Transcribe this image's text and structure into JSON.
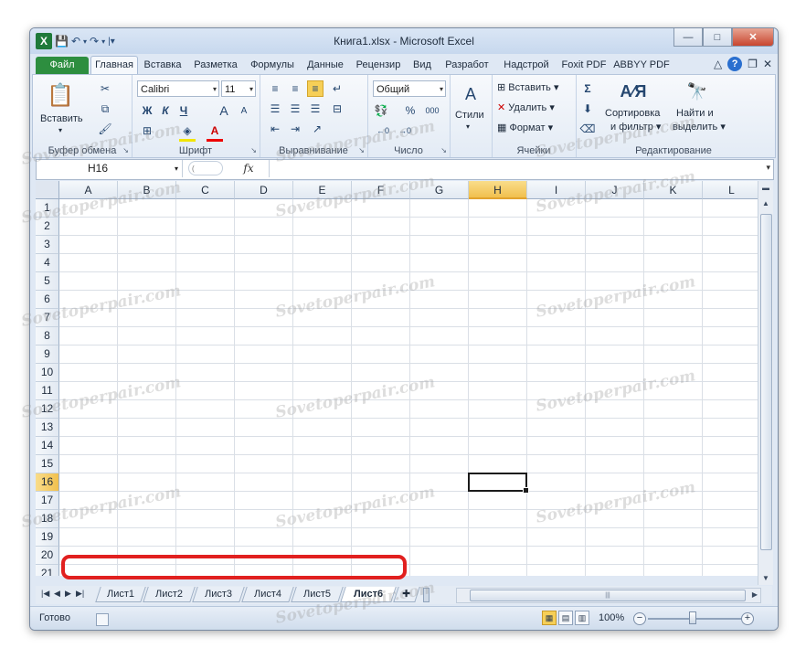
{
  "window": {
    "title": "Книга1.xlsx - Microsoft Excel",
    "quick_access": [
      "save-icon",
      "undo-icon",
      "redo-icon"
    ]
  },
  "tabs": {
    "file": "Файл",
    "items": [
      "Главная",
      "Вставка",
      "Разметка",
      "Формулы",
      "Данные",
      "Рецензир",
      "Вид",
      "Разработ",
      "Надстрой",
      "Foxit PDF",
      "ABBYY PDF"
    ],
    "active": "Главная"
  },
  "ribbon": {
    "clipboard": {
      "label": "Буфер обмена",
      "paste": "Вставить"
    },
    "font": {
      "label": "Шрифт",
      "name": "Calibri",
      "size": "11",
      "bold": "Ж",
      "italic": "К",
      "underline": "Ч",
      "grow": "A",
      "shrink": "A"
    },
    "alignment": {
      "label": "Выравнивание"
    },
    "number": {
      "label": "Число",
      "format": "Общий",
      "percent": "%",
      "thousands": "000"
    },
    "styles": {
      "label": "Стили"
    },
    "cells": {
      "label": "Ячейки",
      "insert": "Вставить",
      "delete": "Удалить",
      "format": "Формат"
    },
    "editing": {
      "label": "Редактирование",
      "sum": "Σ",
      "sort_line1": "Сортировка",
      "sort_line2": "и фильтр",
      "find_line1": "Найти и",
      "find_line2": "выделить"
    }
  },
  "formula_bar": {
    "name_box": "H16",
    "fx": "fx",
    "value": ""
  },
  "grid": {
    "columns": [
      "A",
      "B",
      "C",
      "D",
      "E",
      "F",
      "G",
      "H",
      "I",
      "J",
      "K",
      "L"
    ],
    "rows": [
      "1",
      "2",
      "3",
      "4",
      "5",
      "6",
      "7",
      "8",
      "9",
      "10",
      "11",
      "12",
      "13",
      "14",
      "15",
      "16",
      "17",
      "18",
      "19",
      "20",
      "21"
    ],
    "selected_column": "H",
    "selected_row": "16"
  },
  "sheets": {
    "items": [
      "Лист1",
      "Лист2",
      "Лист3",
      "Лист4",
      "Лист5",
      "Лист6"
    ],
    "active": "Лист6"
  },
  "status": {
    "ready": "Готово",
    "zoom": "100%"
  },
  "watermark": "Sovetoperpair.com",
  "colors": {
    "file_tab": "#2d8e3f",
    "selection_header": "#f6cf57",
    "highlight": "#e1201f"
  }
}
